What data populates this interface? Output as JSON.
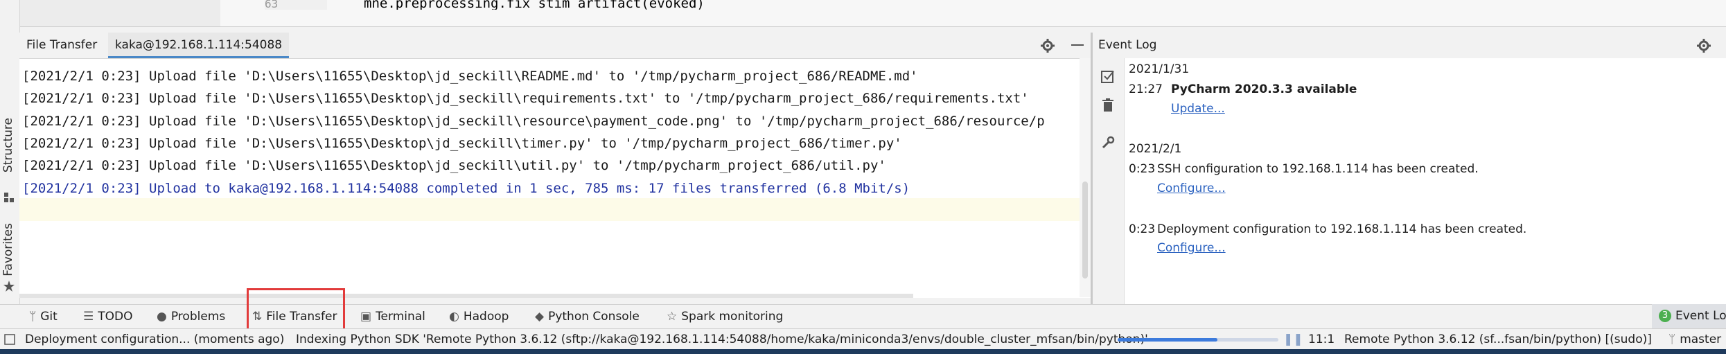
{
  "editor": {
    "line_number": "63",
    "code_line": "mne.preprocessing.fix_stim_artifact(evoked)"
  },
  "left_strip": {
    "structure_label": "Structure",
    "favorites_label": "Favorites"
  },
  "file_transfer": {
    "tab_title": "File Transfer",
    "session_tab": "kaka@192.168.1.114:54088",
    "log_lines": [
      "[2021/2/1 0:23] Upload file 'D:\\Users\\11655\\Desktop\\jd_seckill\\README.md' to '/tmp/pycharm_project_686/README.md'",
      "[2021/2/1 0:23] Upload file 'D:\\Users\\11655\\Desktop\\jd_seckill\\requirements.txt' to '/tmp/pycharm_project_686/requirements.txt'",
      "[2021/2/1 0:23] Upload file 'D:\\Users\\11655\\Desktop\\jd_seckill\\resource\\payment_code.png' to '/tmp/pycharm_project_686/resource/p",
      "[2021/2/1 0:23] Upload file 'D:\\Users\\11655\\Desktop\\jd_seckill\\timer.py' to '/tmp/pycharm_project_686/timer.py'",
      "[2021/2/1 0:23] Upload file 'D:\\Users\\11655\\Desktop\\jd_seckill\\util.py' to '/tmp/pycharm_project_686/util.py'"
    ],
    "summary_line": "[2021/2/1 0:23] Upload to kaka@192.168.1.114:54088 completed in 1 sec, 785 ms: 17 files transferred (6.8 Mbit/s)"
  },
  "event_log": {
    "title": "Event Log",
    "date1": "2021/1/31",
    "entry1_time": "21:27",
    "entry1_text": "PyCharm 2020.3.3 available",
    "entry1_link": "Update...",
    "date2": "2021/2/1",
    "entry2_time": "0:23",
    "entry2_text": "SSH configuration to 192.168.1.114 has been created.",
    "entry2_link": "Configure...",
    "entry3_time": "0:23",
    "entry3_text": "Deployment configuration to 192.168.1.114 has been created.",
    "entry3_link": "Configure..."
  },
  "tool_windows": {
    "git": "Git",
    "todo": "TODO",
    "problems": "Problems",
    "file_transfer": "File Transfer",
    "terminal": "Terminal",
    "hadoop": "Hadoop",
    "python_console": "Python Console",
    "spark_monitoring": "Spark monitoring",
    "event_log": "Event Lo"
  },
  "status_bar": {
    "deployment_text": "Deployment configuration... (moments ago)",
    "indexing_text": "Indexing Python SDK 'Remote Python 3.6.12 (sftp://kaka@192.168.1.114:54088/home/kaka/miniconda3/envs/double_cluster_mfsan/bin/python)'",
    "indexing_progress": 0.62,
    "cursor_position": "11:1",
    "interpreter": "Remote Python 3.6.12 (sf...fsan/bin/python) [(sudo)]",
    "branch": "master"
  },
  "colors": {
    "highlight_box": "#e23b3b",
    "link": "#2b62c0",
    "summary_text": "#2233a0",
    "progress": "#3d7bdc"
  }
}
